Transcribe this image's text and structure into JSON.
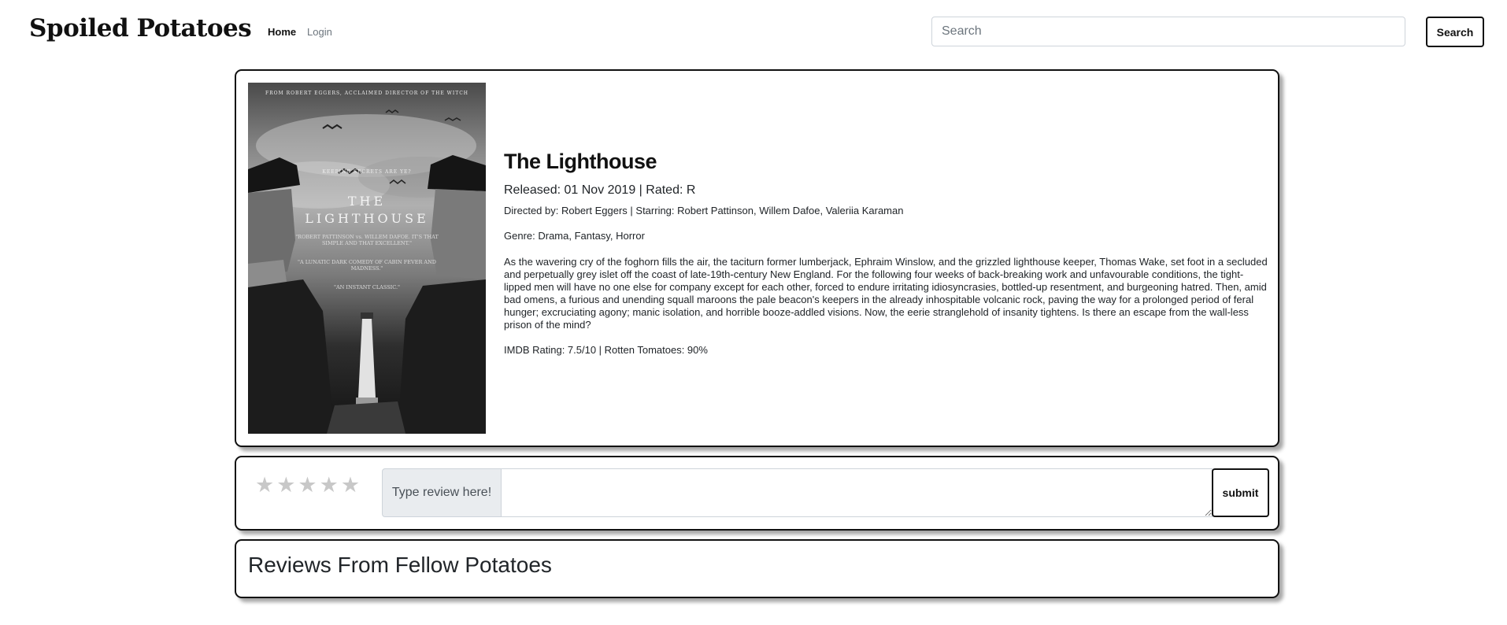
{
  "nav": {
    "brand": "Spoiled Potatoes",
    "links": [
      "Home",
      "Login"
    ],
    "search_placeholder": "Search",
    "search_button": "Search"
  },
  "movie": {
    "poster": {
      "top_credit": "FROM ROBERT EGGERS, ACCLAIMED DIRECTOR OF THE WITCH",
      "tagline": "KEEPING SECRETS ARE YE?",
      "title_line1": "THE",
      "title_line2": "LIGHTHOUSE",
      "quote1": "\"ROBERT PATTINSON vs. WILLEM DAFOE. IT'S THAT SIMPLE AND THAT EXCELLENT.\"",
      "quote2": "\"A LUNATIC DARK COMEDY OF CABIN FEVER AND MADNESS.\"",
      "quote3": "\"AN INSTANT CLASSIC.\""
    },
    "title": "The Lighthouse",
    "released": "Released: 01 Nov 2019 | Rated: R",
    "directed": "Directed by: Robert Eggers | Starring: Robert Pattinson, Willem Dafoe, Valeriia Karaman",
    "genre": "Genre: Drama, Fantasy, Horror",
    "plot": "As the wavering cry of the foghorn fills the air, the taciturn former lumberjack, Ephraim Winslow, and the grizzled lighthouse keeper, Thomas Wake, set foot in a secluded and perpetually grey islet off the coast of late-19th-century New England. For the following four weeks of back-breaking work and unfavourable conditions, the tight-lipped men will have no one else for company except for each other, forced to endure irritating idiosyncrasies, bottled-up resentment, and burgeoning hatred. Then, amid bad omens, a furious and unending squall maroons the pale beacon's keepers in the already inhospitable volcanic rock, paving the way for a prolonged period of feral hunger; excruciating agony; manic isolation, and horrible booze-addled visions. Now, the eerie stranglehold of insanity tightens. Is there an escape from the wall-less prison of the mind?",
    "ratings": "IMDB Rating: 7.5/10 | Rotten Tomatoes: 90%"
  },
  "review_form": {
    "stars": "★★★★★",
    "star_rating": 0,
    "label": "Type review here!",
    "value": "",
    "submit": "submit"
  },
  "reviews": {
    "heading": "Reviews From Fellow Potatoes"
  }
}
